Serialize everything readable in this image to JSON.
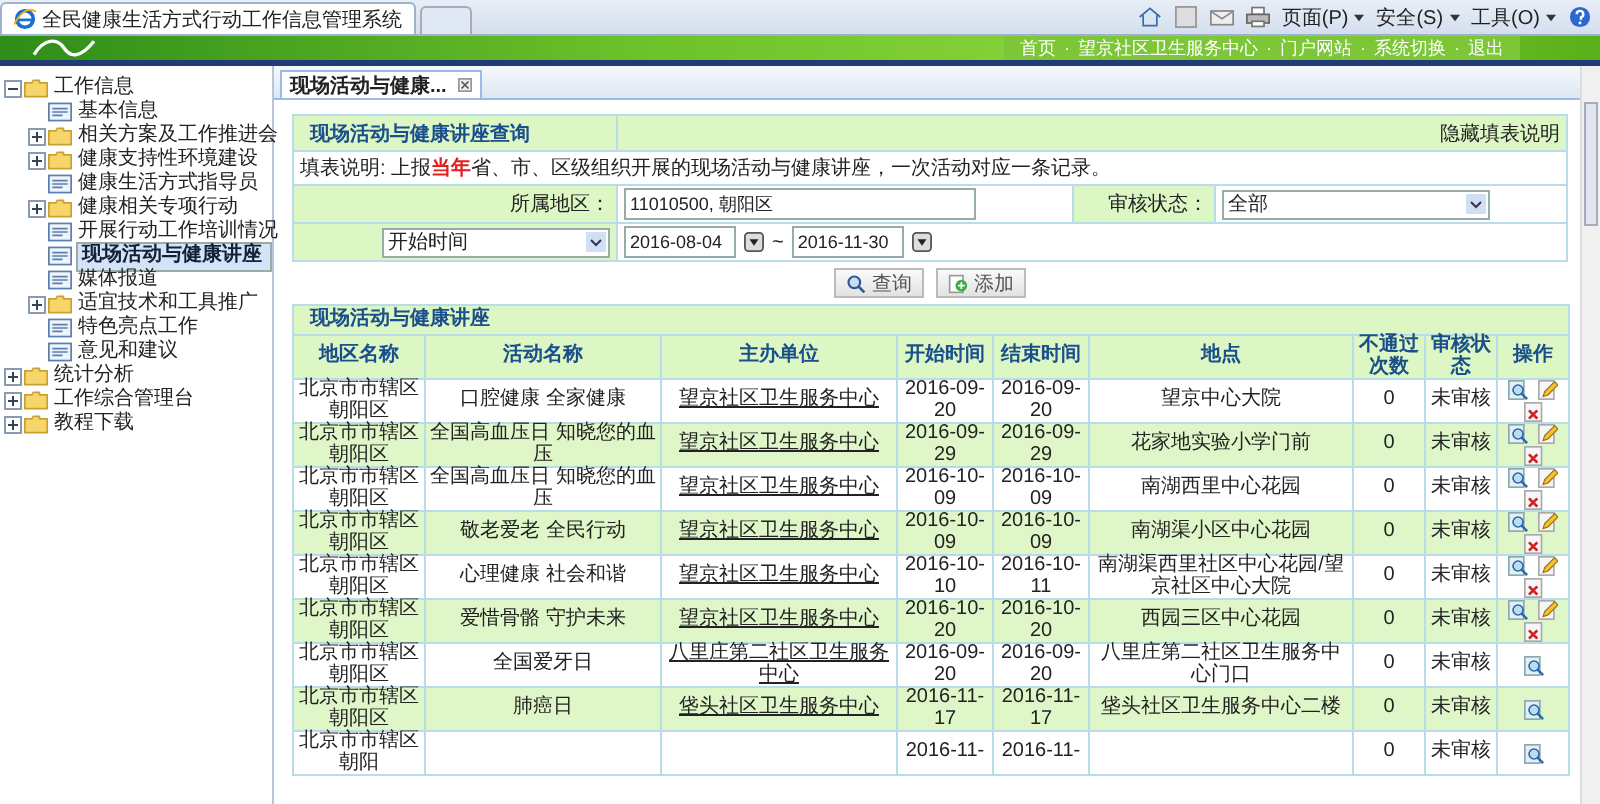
{
  "browser": {
    "tab_title": "全民健康生活方式行动工作信息管理系统",
    "menus": [
      "页面(P)",
      "安全(S)",
      "工具(O)"
    ]
  },
  "banner": {
    "separator": "·",
    "links": [
      "首页",
      "望京社区卫生服务中心",
      "门户网站",
      "系统切换",
      "退出"
    ]
  },
  "sidebar": {
    "items": [
      {
        "label": "工作信息",
        "kind": "folder",
        "expanded": true,
        "selected": false,
        "children": [
          {
            "label": "基本信息",
            "kind": "page",
            "selected": false
          },
          {
            "label": "相关方案及工作推进会",
            "kind": "folder",
            "expanded": false,
            "selected": false
          },
          {
            "label": "健康支持性环境建设",
            "kind": "folder",
            "expanded": false,
            "selected": false
          },
          {
            "label": "健康生活方式指导员",
            "kind": "page",
            "selected": false
          },
          {
            "label": "健康相关专项行动",
            "kind": "folder",
            "expanded": false,
            "selected": false
          },
          {
            "label": "开展行动工作培训情况",
            "kind": "page",
            "selected": false
          },
          {
            "label": "现场活动与健康讲座",
            "kind": "page",
            "selected": true
          },
          {
            "label": "媒体报道",
            "kind": "page",
            "selected": false
          },
          {
            "label": "适宜技术和工具推广",
            "kind": "folder",
            "expanded": false,
            "selected": false
          },
          {
            "label": "特色亮点工作",
            "kind": "page",
            "selected": false
          },
          {
            "label": "意见和建议",
            "kind": "page",
            "selected": false
          }
        ]
      },
      {
        "label": "统计分析",
        "kind": "folder",
        "expanded": false,
        "selected": false
      },
      {
        "label": "工作综合管理台",
        "kind": "folder",
        "expanded": false,
        "selected": false
      },
      {
        "label": "教程下载",
        "kind": "folder",
        "expanded": false,
        "selected": false
      }
    ]
  },
  "content_tab": {
    "label": "现场活动与健康...",
    "selected": true
  },
  "query": {
    "title": "现场活动与健康讲座查询",
    "toggle_link": "隐藏填表说明",
    "note": "填表说明: 上报**当年**省、市、区级组织开展的现场活动与健康讲座，一次活动对应一条记录。",
    "region_label": "所属地区：",
    "region_value": "11010500, 朝阳区",
    "status_label": "审核状态：",
    "status_value": "全部",
    "date_type": "开始时间",
    "date_from": "2016-08-04",
    "date_separator": "~",
    "date_to": "2016-11-30",
    "buttons": [
      {
        "label": "查询",
        "kind": "search"
      },
      {
        "label": "添加",
        "kind": "add"
      }
    ]
  },
  "table": {
    "title": "现场活动与健康讲座",
    "columns": [
      "地区名称",
      "活动名称",
      "主办单位",
      "开始时间",
      "结束时间",
      "地点",
      "不通过次数",
      "审核状态",
      "操作"
    ],
    "rows": [
      {
        "area": "北京市市辖区朝阳区",
        "activity": "口腔健康 全家健康",
        "host": "望京社区卫生服务中心",
        "start": "2016-09-20",
        "end": "2016-09-20",
        "place": "望京中心大院",
        "fail_count": "0",
        "status": "未审核",
        "editable": true
      },
      {
        "area": "北京市市辖区朝阳区",
        "activity": "全国高血压日 知晓您的血压",
        "host": "望京社区卫生服务中心",
        "start": "2016-09-29",
        "end": "2016-09-29",
        "place": "花家地实验小学门前",
        "fail_count": "0",
        "status": "未审核",
        "editable": true
      },
      {
        "area": "北京市市辖区朝阳区",
        "activity": "全国高血压日 知晓您的血压",
        "host": "望京社区卫生服务中心",
        "start": "2016-10-09",
        "end": "2016-10-09",
        "place": "南湖西里中心花园",
        "fail_count": "0",
        "status": "未审核",
        "editable": true
      },
      {
        "area": "北京市市辖区朝阳区",
        "activity": "敬老爱老 全民行动",
        "host": "望京社区卫生服务中心",
        "start": "2016-10-09",
        "end": "2016-10-09",
        "place": "南湖渠小区中心花园",
        "fail_count": "0",
        "status": "未审核",
        "editable": true
      },
      {
        "area": "北京市市辖区朝阳区",
        "activity": "心理健康 社会和谐",
        "host": "望京社区卫生服务中心",
        "start": "2016-10-10",
        "end": "2016-10-11",
        "place": "南湖渠西里社区中心花园/望京社区中心大院",
        "fail_count": "0",
        "status": "未审核",
        "editable": true
      },
      {
        "area": "北京市市辖区朝阳区",
        "activity": "爱惜骨骼 守护未来",
        "host": "望京社区卫生服务中心",
        "start": "2016-10-20",
        "end": "2016-10-20",
        "place": "西园三区中心花园",
        "fail_count": "0",
        "status": "未审核",
        "editable": true
      },
      {
        "area": "北京市市辖区朝阳区",
        "activity": "全国爱牙日",
        "host": "八里庄第二社区卫生服务中心",
        "start": "2016-09-20",
        "end": "2016-09-20",
        "place": "八里庄第二社区卫生服务中心门口",
        "fail_count": "0",
        "status": "未审核",
        "editable": false
      },
      {
        "area": "北京市市辖区朝阳区",
        "activity": "肺癌日",
        "host": "垡头社区卫生服务中心",
        "start": "2016-11-17",
        "end": "2016-11-17",
        "place": "垡头社区卫生服务中心二楼",
        "fail_count": "0",
        "status": "未审核",
        "editable": false
      },
      {
        "area": "北京市市辖区朝阳",
        "start": "2016-11-",
        "end": "2016-11-",
        "fail_count": "0",
        "status": "未审核",
        "editable": false
      }
    ]
  }
}
